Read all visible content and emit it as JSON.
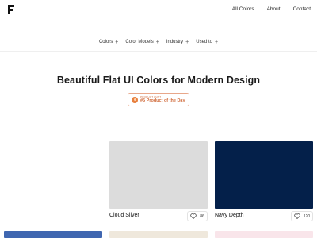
{
  "header": {
    "nav": [
      "All Colors",
      "About",
      "Contact"
    ]
  },
  "categories": [
    {
      "label": "Colors",
      "icon": "plus-icon"
    },
    {
      "label": "Color Models",
      "icon": "plus-icon"
    },
    {
      "label": "Industry",
      "icon": "plus-icon"
    },
    {
      "label": "Used to",
      "icon": "plus-icon"
    }
  ],
  "hero": {
    "title": "Beautiful Flat UI Colors for Modern Design",
    "badge": {
      "small": "PRODUCT HUNT",
      "main": "#5 Product of the Day"
    }
  },
  "cards": [
    {
      "name": "Cloud Silver",
      "likes": "86",
      "color": "#dcdcdc"
    },
    {
      "name": "Navy Depth",
      "likes": "120",
      "color": "#04204a"
    }
  ],
  "partial_cards": [
    {
      "color": "#3f66b0"
    },
    {
      "color": "#efe8dc"
    },
    {
      "color": "#f9e5ea"
    }
  ],
  "symbols": {
    "plus": "+"
  }
}
